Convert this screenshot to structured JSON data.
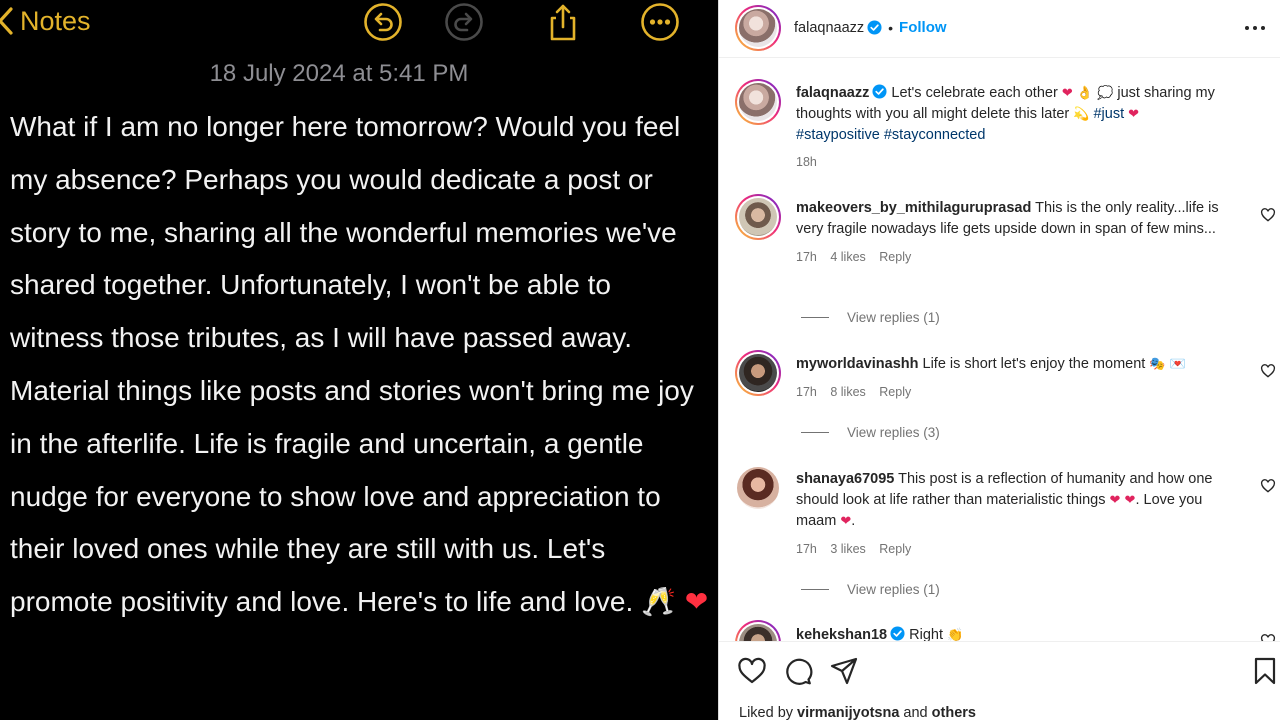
{
  "notes": {
    "back_label": "Notes",
    "date": "18 July 2024 at 5:41 PM",
    "body": "What if I am no longer here tomorrow? Would you feel my absence? Perhaps you would dedicate a post or story to me, sharing all the wonderful memories we've shared together. Unfortunately, I won't be able to witness those tributes, as I will have passed away. Material things like posts and stories won't bring me joy in the afterlife. Life is fragile and uncertain, a gentle nudge for everyone to show love and appreciation to their loved ones while they are still with us. Let's promote positivity and love. Here's to life and love.",
    "body_end_emoji": "🥂 ❤",
    "accent_color": "#e3b32b",
    "icons": [
      "back-chevron-icon",
      "undo-icon",
      "redo-icon",
      "share-icon",
      "more-circle-icon"
    ]
  },
  "instagram": {
    "header": {
      "username": "falaqnaazz",
      "separator": "•",
      "follow_label": "Follow",
      "more_label": "..."
    },
    "caption": {
      "username": "falaqnaazz",
      "text_1": "Let's celebrate each other",
      "emoji_1": "❤ 👌 💭",
      "text_2": "just sharing my thoughts with you all might delete this later",
      "emoji_2": "💫",
      "hashtag_just": "#just",
      "emoji_3": "❤",
      "hashtags": "#staypositive #stayconnected",
      "time": "18h"
    },
    "comments": [
      {
        "username": "makeovers_by_mithilaguruprasad",
        "text": "This is the only reality...life is very fragile nowadays life gets upside down in span of few mins...",
        "time": "17h",
        "likes": "4 likes",
        "reply_label": "Reply",
        "view_replies": "View replies (1)"
      },
      {
        "username": "myworldavinashh",
        "text": "Life is short let's enjoy the moment",
        "emoji": "🎭 💌",
        "time": "17h",
        "likes": "8 likes",
        "reply_label": "Reply",
        "view_replies": "View replies (3)"
      },
      {
        "username": "shanaya67095",
        "text": "This post is a reflection of humanity and how one should look at life rather than materialistic things",
        "emoji": "❤ ❤",
        "text_2": "Love you maam",
        "emoji_2": "❤",
        "time": "17h",
        "likes": "3 likes",
        "reply_label": "Reply",
        "view_replies": "View replies (1)"
      },
      {
        "username": "kehekshan18",
        "text": "Right",
        "emoji": "👏"
      }
    ],
    "footer": {
      "liked_by_prefix": "Liked by",
      "liked_by_user": "virmanijyotsna",
      "liked_by_and": "and",
      "liked_by_others": "others"
    },
    "colors": {
      "link_blue": "#0095f6",
      "hashtag": "#00376b",
      "muted": "#737373",
      "heart": "#e0245e"
    }
  }
}
